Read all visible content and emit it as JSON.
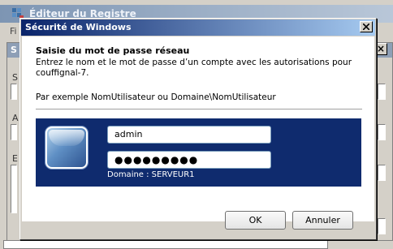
{
  "background_window": {
    "title": "Éditeur du Registre",
    "menu_first": "Fi",
    "sub_label": "S",
    "field_labels": [
      "S",
      "A",
      "E"
    ]
  },
  "dialog": {
    "title": "Sécurité de Windows",
    "heading": "Saisie du mot de passe réseau",
    "description": "Entrez le nom et le mot de passe d’un compte avec les autorisations pour couffignal-7.",
    "example": "Par exemple NomUtilisateur ou Domaine\\NomUtilisateur",
    "username": "admin",
    "password_mask": "●●●●●●●●●",
    "domain": "Domaine : SERVEUR1",
    "ok_label": "OK",
    "cancel_label": "Annuler"
  },
  "colors": {
    "title_gradient_start": "#0a246a",
    "title_gradient_end": "#a6caf0",
    "credential_tile": "#0f2b6e"
  },
  "icons": {
    "title_close": "close-icon",
    "registry_app": "registry-editor-icon",
    "user_tile": "user-tile-icon"
  }
}
